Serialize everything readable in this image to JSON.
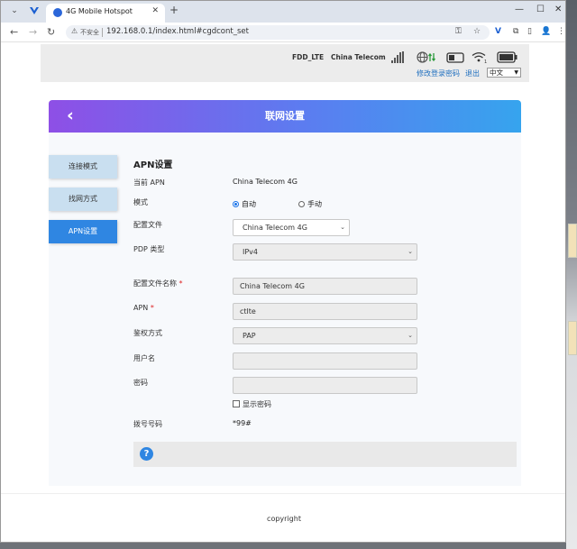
{
  "browser": {
    "tab_title": "4G Mobile Hotspot",
    "url": "192.168.0.1/index.html#cgdcont_set",
    "security_label": "不安全"
  },
  "header": {
    "network_type": "FDD_LTE",
    "carrier": "China Telecom",
    "change_password_link": "修改登录密码",
    "logout_link": "退出",
    "language": "中文"
  },
  "banner": {
    "title": "联网设置"
  },
  "sidebar": {
    "items": [
      {
        "label": "连接模式",
        "active": false
      },
      {
        "label": "找网方式",
        "active": false
      },
      {
        "label": "APN设置",
        "active": true
      }
    ]
  },
  "form": {
    "section_title": "APN设置",
    "current_apn_label": "当前 APN",
    "current_apn_value": "China Telecom 4G",
    "mode_label": "模式",
    "mode_auto": "自动",
    "mode_manual": "手动",
    "mode_selected": "自动",
    "profile_label": "配置文件",
    "profile_value": "China Telecom 4G",
    "pdp_label": "PDP 类型",
    "pdp_value": "IPv4",
    "profile_name_label": "配置文件名称",
    "profile_name_value": "China Telecom 4G",
    "apn_label": "APN",
    "apn_value": "ctlte",
    "auth_label": "鉴权方式",
    "auth_value": "PAP",
    "username_label": "用户名",
    "username_value": "",
    "password_label": "密码",
    "password_value": "",
    "show_password_label": "显示密码",
    "dial_label": "拨号号码",
    "dial_value": "*99#",
    "required_mark": "*"
  },
  "footer": {
    "copyright": "copyright"
  },
  "colors": {
    "accent": "#2f86e2",
    "banner_gradient_start": "#8e4fe6",
    "banner_gradient_end": "#36a4ee",
    "link": "#1f6fbf"
  }
}
